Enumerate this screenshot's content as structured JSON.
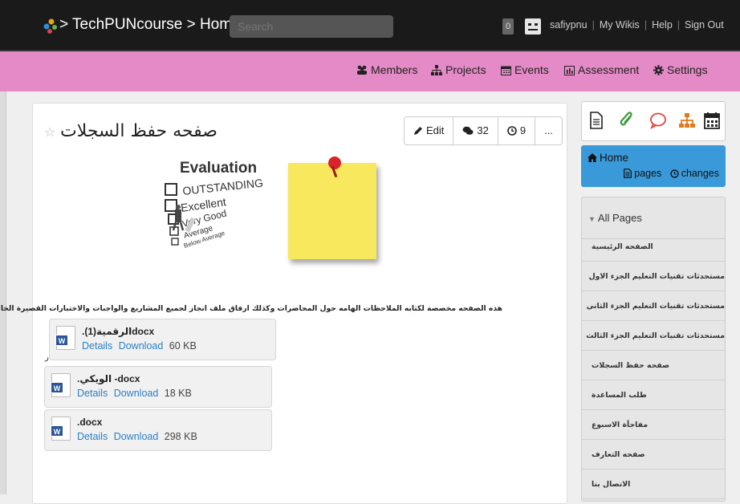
{
  "topbar": {
    "breadcrumb": "> TechPUNcourse > Home",
    "search_placeholder": "Search",
    "notification_count": "0",
    "links": [
      "safiypnu",
      "My Wikis",
      "Help",
      "Sign Out"
    ]
  },
  "nav": {
    "items": [
      {
        "label": "Members",
        "icon": "members-icon"
      },
      {
        "label": "Projects",
        "icon": "projects-icon"
      },
      {
        "label": "Events",
        "icon": "calendar-icon"
      },
      {
        "label": "Assessment",
        "icon": "assessment-icon"
      },
      {
        "label": "Settings",
        "icon": "gear-icon"
      }
    ]
  },
  "page": {
    "title": "صفحه حفظ السجلات",
    "edit_label": "Edit",
    "comment_count": "32",
    "history_count": "9",
    "more_label": "...",
    "image_eval": {
      "heading": "Evaluation",
      "items": [
        "OUTSTANDING",
        "Excellent",
        "Very Good",
        "Average",
        "Below Average"
      ]
    },
    "description": "هذه الصفحه مخصصة لكتابه الملاحظات الهامه حول المحاضرات وكذلك ارفاق ملف انجاز لجميع المشاريع والواجبات والاختبارات القصيرة الخاصه بالمقر",
    "stray_char": "ر",
    "files": [
      {
        "name": ".(الرقمية(1docx",
        "details": "Details",
        "download": "Download",
        "size": "60 KB"
      },
      {
        "name": ".الويكي -docx",
        "details": "Details",
        "download": "Download",
        "size": "18 KB"
      },
      {
        "name": ".docx",
        "details": "Details",
        "download": "Download",
        "size": "298 KB"
      }
    ]
  },
  "sidebar": {
    "icons": [
      "page-icon",
      "paperclip-icon",
      "comment-icon",
      "sitemap-icon",
      "calendar-icon"
    ],
    "home": {
      "title": "Home",
      "pages_label": "pages",
      "changes_label": "changes"
    },
    "all_pages_label": "All Pages",
    "pages": [
      "الصفحه الرئيسية",
      "مستحدثات تقنيات التعليم الجزء الاول",
      "مستحدثات تقنيات التعليم الجزء الثاني",
      "مستحدثات تقنيات التعليم الجزء الثالث",
      "صفحه حفظ السجلات",
      "طلب المساعدة",
      "مفاجأة الاسبوع",
      "صفحه التعارف",
      "الاتصال بنا"
    ]
  },
  "colors": {
    "topbar_bg": "#1a1a1a",
    "nav_bg": "#e48ac7",
    "accent_blue": "#3a9ad9",
    "link_blue": "#2a7fc7",
    "icon_green": "#3c9a3c",
    "icon_red": "#e0463a",
    "icon_orange": "#e07b1c"
  }
}
